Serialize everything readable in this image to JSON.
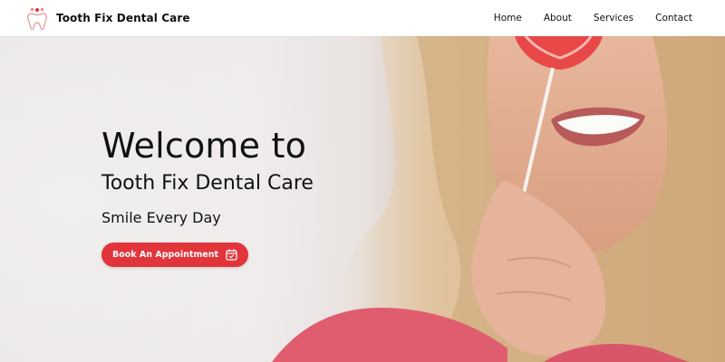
{
  "header": {
    "brand_name": "Tooth Fix Dental Care",
    "logo_icon": "tooth-icon",
    "nav": [
      {
        "label": "Home"
      },
      {
        "label": "About"
      },
      {
        "label": "Services"
      },
      {
        "label": "Contact"
      }
    ]
  },
  "hero": {
    "title": "Welcome to",
    "subtitle": "Tooth Fix Dental Care",
    "tagline": "Smile Every Day",
    "cta_label": "Book An Appointment",
    "cta_icon": "calendar-icon",
    "image_alt": "smiling woman holding a heart-shaped lollipop"
  },
  "colors": {
    "accent": "#e1353b",
    "text": "#111111",
    "background": "#ffffff"
  }
}
